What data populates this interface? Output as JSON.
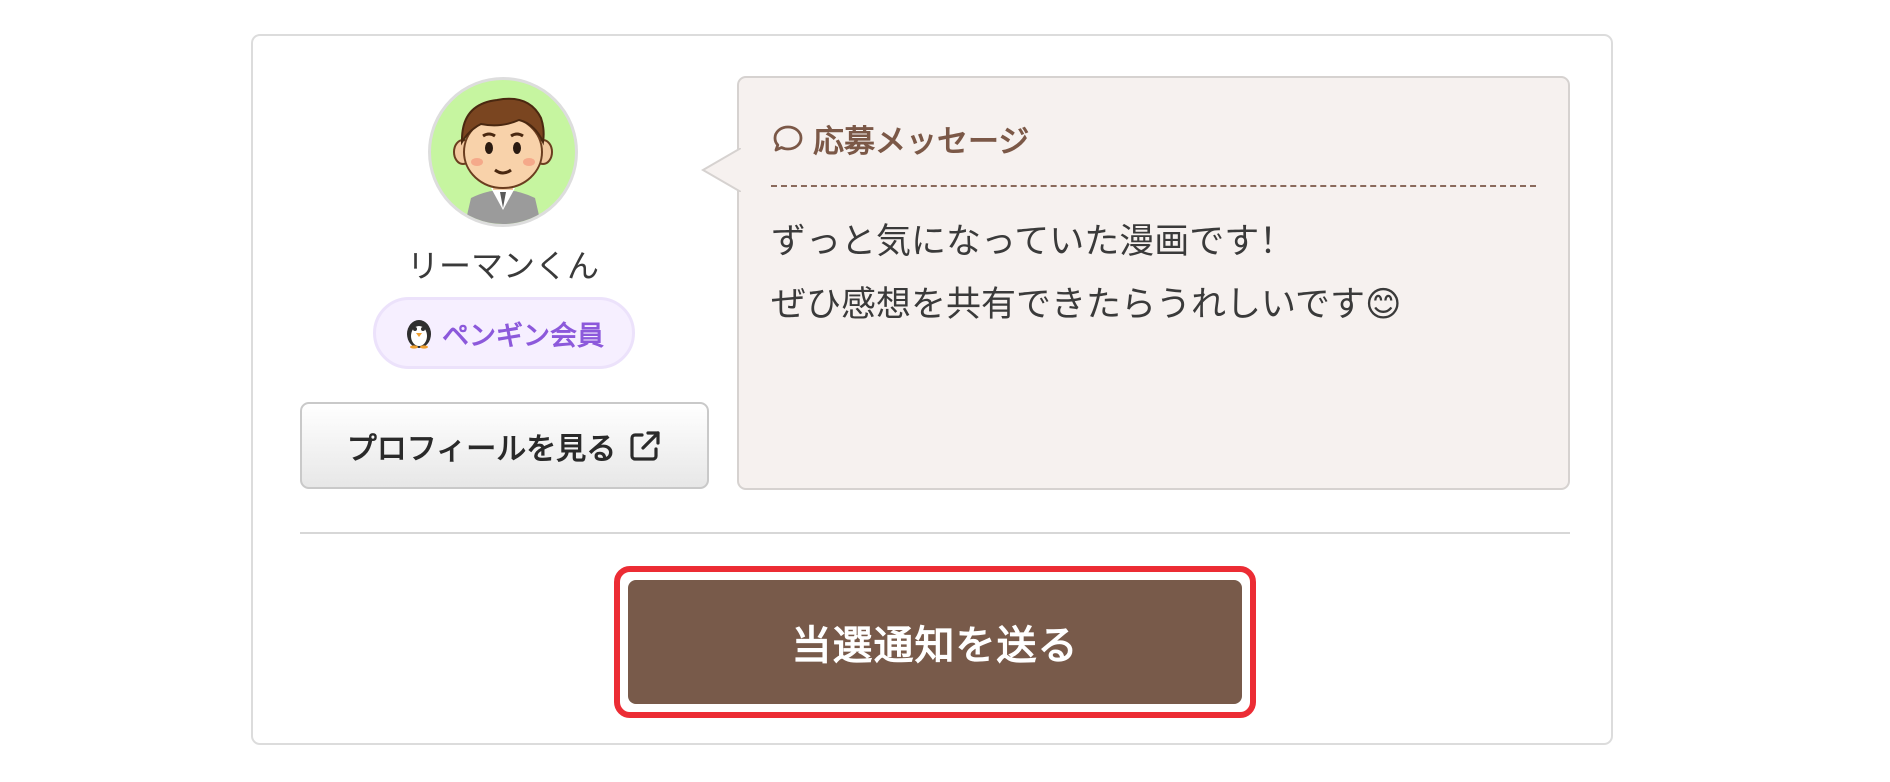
{
  "user": {
    "name": "リーマンくん",
    "membership_badge": "ペンギン会員",
    "profile_button_label": "プロフィールを見る"
  },
  "message": {
    "title": "応募メッセージ",
    "lines": [
      "ずっと気になっていた漫画です！",
      "ぜひ感想を共有できたらうれしいです😊"
    ]
  },
  "actions": {
    "send_label": "当選通知を送る"
  },
  "icons": {
    "badge": "penguin-icon",
    "profile": "external-link-icon",
    "message": "chat-bubble-icon"
  },
  "colors": {
    "primary_button": "#785a4a",
    "highlight_outline": "#ec2c34",
    "badge_text": "#8c59db",
    "message_title": "#7b5847",
    "message_background": "#f6f1ef",
    "avatar_background": "#c6f5a0"
  }
}
